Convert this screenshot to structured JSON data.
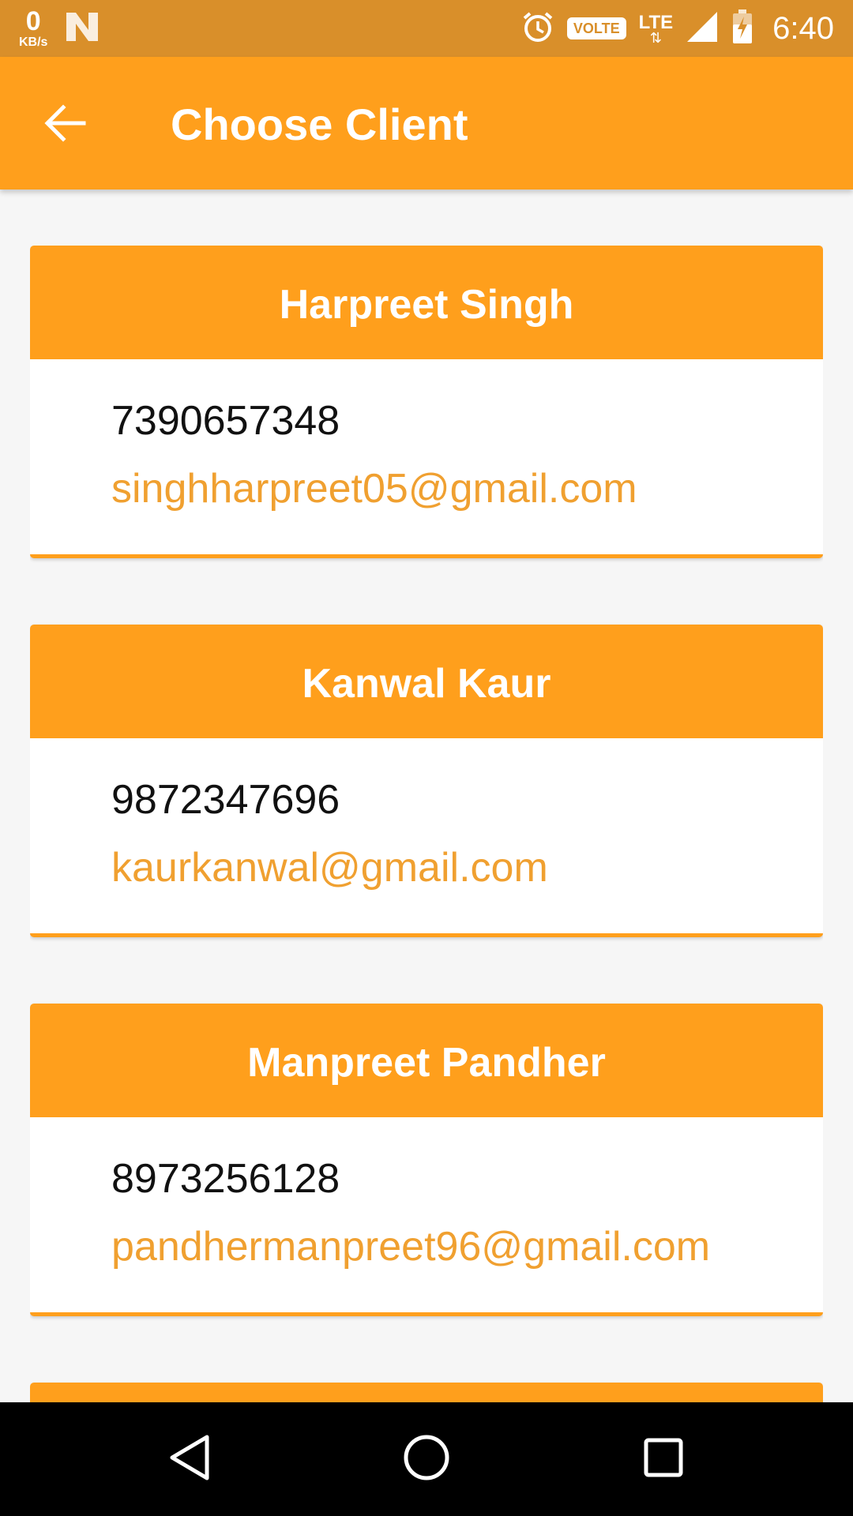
{
  "status_bar": {
    "speed_value": "0",
    "speed_unit": "KB/s",
    "volte": "VOLTE",
    "network": "LTE",
    "time": "6:40"
  },
  "app_bar": {
    "title": "Choose Client",
    "back_icon": "arrow-back-icon"
  },
  "clients": [
    {
      "name": "Harpreet Singh",
      "phone": "7390657348",
      "email": "singhharpreet05@gmail.com"
    },
    {
      "name": "Kanwal Kaur",
      "phone": "9872347696",
      "email": "kaurkanwal@gmail.com"
    },
    {
      "name": "Manpreet Pandher",
      "phone": "8973256128",
      "email": "pandhermanpreet96@gmail.com"
    }
  ],
  "colors": {
    "accent": "#ff9f1c",
    "status_bar": "#d98f2a",
    "email_text": "#f0a030"
  },
  "nav_bar": {
    "icons": [
      "back-triangle-icon",
      "home-circle-icon",
      "recents-square-icon"
    ]
  }
}
